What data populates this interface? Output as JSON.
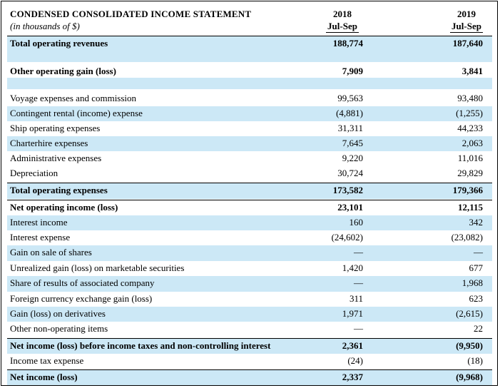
{
  "header": {
    "title": "CONDENSED CONSOLIDATED INCOME STATEMENT",
    "subtitle": "(in thousands of $)",
    "col1_year": "2018",
    "col1_period": "Jul-Sep",
    "col2_year": "2019",
    "col2_period": "Jul-Sep"
  },
  "rows": [
    {
      "label": "Total operating revenues",
      "v2018": "188,774",
      "v2019": "187,640"
    },
    {
      "label": "Other operating gain (loss)",
      "v2018": "7,909",
      "v2019": "3,841"
    },
    {
      "label": "Voyage expenses and commission",
      "v2018": "99,563",
      "v2019": "93,480"
    },
    {
      "label": "Contingent rental (income) expense",
      "v2018": "(4,881)",
      "v2019": "(1,255)"
    },
    {
      "label": "Ship operating expenses",
      "v2018": "31,311",
      "v2019": "44,233"
    },
    {
      "label": "Charterhire expenses",
      "v2018": "7,645",
      "v2019": "2,063"
    },
    {
      "label": "Administrative expenses",
      "v2018": "9,220",
      "v2019": "11,016"
    },
    {
      "label": "Depreciation",
      "v2018": "30,724",
      "v2019": "29,829"
    },
    {
      "label": "Total operating expenses",
      "v2018": "173,582",
      "v2019": "179,366"
    },
    {
      "label": "Net operating income (loss)",
      "v2018": "23,101",
      "v2019": "12,115"
    },
    {
      "label": "Interest income",
      "v2018": "160",
      "v2019": "342"
    },
    {
      "label": "Interest expense",
      "v2018": "(24,602)",
      "v2019": "(23,082)"
    },
    {
      "label": "Gain on sale of shares",
      "v2018": "—",
      "v2019": "—"
    },
    {
      "label": "Unrealized gain (loss) on marketable securities",
      "v2018": "1,420",
      "v2019": "677"
    },
    {
      "label": "Share of results of associated company",
      "v2018": "—",
      "v2019": "1,968"
    },
    {
      "label": "Foreign currency exchange gain (loss)",
      "v2018": "311",
      "v2019": "623"
    },
    {
      "label": "Gain (loss) on derivatives",
      "v2018": "1,971",
      "v2019": "(2,615)"
    },
    {
      "label": "Other non-operating items",
      "v2018": "—",
      "v2019": "22"
    },
    {
      "label": "Net income (loss) before income taxes and non-controlling interest",
      "v2018": "2,361",
      "v2019": "(9,950)"
    },
    {
      "label": "Income tax expense",
      "v2018": "(24)",
      "v2019": "(18)"
    },
    {
      "label": "Net income (loss)",
      "v2018": "2,337",
      "v2019": "(9,968)"
    }
  ]
}
